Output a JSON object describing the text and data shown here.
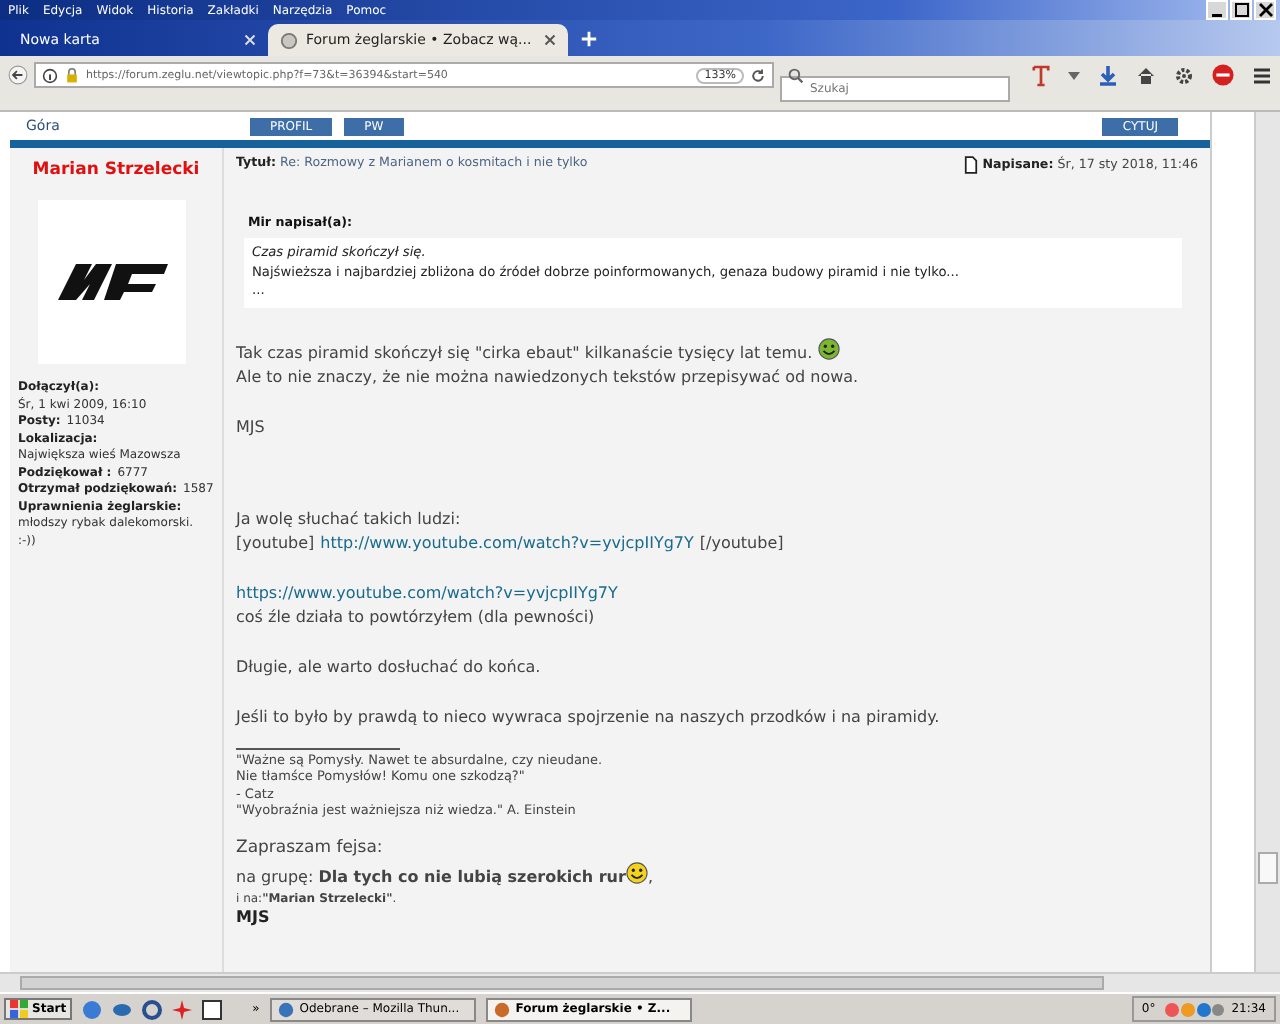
{
  "menu": [
    "Plik",
    "Edycja",
    "Widok",
    "Historia",
    "Zakładki",
    "Narzędzia",
    "Pomoc"
  ],
  "tabs": [
    {
      "label": "Nowa karta",
      "selected": false
    },
    {
      "label": "Forum żeglarskie • Zobacz wą...",
      "selected": true
    }
  ],
  "address_bar": {
    "url": "https://forum.zeglu.net/viewtopic.php?f=73&t=36394&start=540",
    "zoom": "133%"
  },
  "search": {
    "placeholder": "Szukaj"
  },
  "topbar": {
    "link": "Góra",
    "buttons": [
      "PROFIL",
      "PW"
    ],
    "quote_button": "CYTUJ"
  },
  "author": {
    "name": "Marian Strzelecki",
    "fields": [
      {
        "label": "Dołączył(a):",
        "value": "Śr, 1 kwi 2009, 16:10"
      },
      {
        "label": "Posty:",
        "value": "11034"
      },
      {
        "label": "Lokalizacja:",
        "value": "Największa wieś Mazowsza"
      },
      {
        "label": "Podziękował :",
        "value": "6777"
      },
      {
        "label": "Otrzymał podziękowań:",
        "value": "1587"
      },
      {
        "label": "Uprawnienia żeglarskie:",
        "value": "młodszy rybak dalekomorski. :-))"
      }
    ]
  },
  "post": {
    "title_label": "Tytuł:",
    "title": "Re: Rozmowy z Marianem o kosmitach i nie tylko",
    "date_label": "Napisane:",
    "date": "Śr, 17 sty 2018, 11:46",
    "quote": {
      "author": "Mir napisał(a):",
      "lines": [
        "Czas piramid skończył się.",
        "Najświeższa i najbardziej zbliżona do źródeł dobrze poinformowanych, genaza budowy piramid i nie tylko...",
        "..."
      ]
    },
    "paragraphs": [
      [
        [
          {
            "kind": "text",
            "text": "Tak czas piramid skończył się \"cirka ebaut\" kilkanaście tysięcy lat temu."
          },
          {
            "kind": "grin"
          }
        ],
        [
          {
            "kind": "text",
            "text": "Ale to nie znaczy, że nie można nawiedzonych tekstów przepisywać od nowa."
          }
        ]
      ],
      [
        [
          {
            "kind": "text",
            "text": "MJS"
          }
        ]
      ],
      [
        [
          {
            "kind": "text",
            "text": "Ja wolę słuchać takich ludzi:"
          }
        ],
        [
          {
            "kind": "text",
            "text": "[youtube]"
          },
          {
            "kind": "link",
            "text": "http://www.youtube.com/watch?v=yvjcpIIYg7Y"
          },
          {
            "kind": "text",
            "text": "[/youtube]"
          }
        ]
      ],
      [
        [
          {
            "kind": "link",
            "text": "https://www.youtube.com/watch?v=yvjcpIIYg7Y"
          }
        ],
        [
          {
            "kind": "text",
            "text": "coś źle działa to powtórzyłem (dla pewności)"
          }
        ]
      ],
      [
        [
          {
            "kind": "text",
            "text": "Długie, ale warto dosłuchać do końca."
          }
        ]
      ],
      [
        [
          {
            "kind": "text",
            "text": "Jeśli to było by prawdą to nieco wywraca spojrzenie na naszych przodków i na piramidy."
          }
        ]
      ]
    ],
    "signature": {
      "quote_lines": [
        "\"Ważne są Pomysły. Nawet te absurdalne, czy nieudane.",
        "Nie tłamśce Pomysłów! Komu one szkodzą?\"",
        "- Catz",
        "\"Wyobraźnia jest ważniejsza niż wiedza.\" A. Einstein"
      ],
      "invite_heading": "Zapraszam fejsa:",
      "invite_lines": [
        [
          {
            "kind": "text",
            "text": "na grupę: **Dla tych co nie lubią szerokich rur**"
          },
          {
            "kind": "wink"
          },
          {
            "kind": "text",
            "text": ","
          }
        ],
        [
          {
            "kind": "text",
            "text": "i na:**\"Marian Strzelecki\"**."
          }
        ]
      ],
      "closing": "MJS"
    }
  },
  "taskbar": {
    "start": "Start",
    "more": "»",
    "windows": [
      {
        "label": "Odebrane – Mozilla Thun...",
        "selected": false
      },
      {
        "label": "Forum żeglarskie • Z...",
        "selected": true
      }
    ],
    "temperature": "0°",
    "clock": "21:34"
  }
}
